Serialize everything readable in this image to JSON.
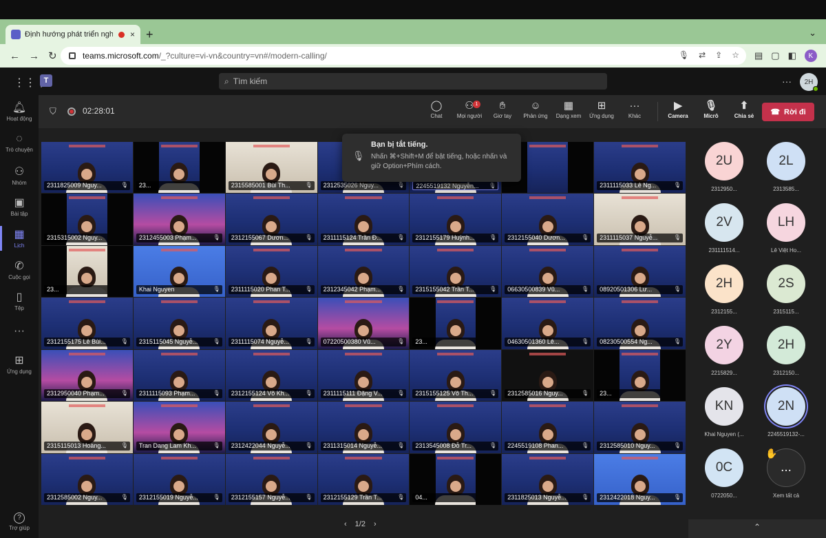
{
  "browser": {
    "tab_title": "Định hướng phát triển nghề",
    "tab_close": "×",
    "new_tab": "+",
    "url_domain": "teams.microsoft.com",
    "url_path": "/_?culture=vi-vn&country=vn#/modern-calling/",
    "profile_initial": "K"
  },
  "teams": {
    "search_placeholder": "Tìm kiếm",
    "user_initials": "2H",
    "rail": [
      "Hoạt động",
      "Trò chuyện",
      "Nhóm",
      "Bài tập",
      "Lịch",
      "Cuộc gọi",
      "Tệp",
      "",
      "Ứng dụng"
    ],
    "help": "Trợ giúp"
  },
  "meeting": {
    "timer": "02:28:01",
    "controls": [
      "Chat",
      "Mọi người",
      "Giơ tay",
      "Phản ứng",
      "Dạng xem",
      "Ứng dụng",
      "Khác"
    ],
    "people_badge": "1",
    "devices": [
      "Camera",
      "Micrô",
      "Chia sẻ"
    ],
    "leave": "Rời đi",
    "pager": "1/2"
  },
  "toast": {
    "title": "Bạn bị tắt tiếng.",
    "body": "Nhấn ⌘+Shift+M để bật tiếng, hoặc nhấn và giữ Option+Phím cách."
  },
  "grid_names": [
    "2311825009 Nguy...",
    "23...",
    "2315585001 Bùi Th...",
    "2312535026 Nguy...",
    "2245519132 Nguyễn...",
    "",
    "2311115033 Lê Ng...",
    "2315315002 Nguy...",
    "2312455003 Phạm...",
    "2312155067 Dươn...",
    "2311115124 Trần Đ...",
    "2312155179 Huỳnh...",
    "2312155040 Dươn...",
    "2311115037 Nguyễ...",
    "23...",
    "Khai Nguyen",
    "2311115020 Phan T...",
    "2312345042 Phạm...",
    "2315155042 Trần T...",
    "06630500839 Vũ...",
    "08920501306 Lư...",
    "2312155175 Lê Bùi...",
    "2315115045 Nguyễ...",
    "2311115074 Nguyễ...",
    "07220500380 Vũ...",
    "23...",
    "04630501360 Lê...",
    "08230500554 Ng...",
    "2312950040 Phạm...",
    "2311115093 Phạm...",
    "2312155124 Võ Kh...",
    "2311115111 Đặng V...",
    "2315155125 Võ Th...",
    "2312585016 Nguy...",
    "23...",
    "2315115013 Hoàng...",
    "Tran Dang Lam Kh...",
    "2312422044 Nguyễ...",
    "2311315014 Nguyễ...",
    "2313545008 Đỗ Tr...",
    "2245519108 Phan...",
    "2312585010 Nguy...",
    "2312585002 Nguy...",
    "2312155019 Nguyễ...",
    "2312155157 Nguyễ...",
    "2312155129 Trần T...",
    "04...",
    "2311825013 Nguyễ...",
    "2312422018 Nguy..."
  ],
  "roster": [
    {
      "initials": "2U",
      "label": "2312950...",
      "color": "#f9d4d4"
    },
    {
      "initials": "2L",
      "label": "2313585...",
      "color": "#cfe0f5"
    },
    {
      "initials": "2V",
      "label": "231111514...",
      "color": "#d7e6ef"
    },
    {
      "initials": "LH",
      "label": "Lê Việt Ho...",
      "color": "#f6d6df"
    },
    {
      "initials": "2H",
      "label": "2312155...",
      "color": "#fbe3c9"
    },
    {
      "initials": "2S",
      "label": "2315115...",
      "color": "#dbe9d2"
    },
    {
      "initials": "2Y",
      "label": "2215829...",
      "color": "#f3d3e3"
    },
    {
      "initials": "2H",
      "label": "2312150...",
      "color": "#d3ead8"
    },
    {
      "initials": "KN",
      "label": "Khai Nguyen (...",
      "color": "#e4e4ea"
    },
    {
      "initials": "2N",
      "label": "2245519132-...",
      "color": "#cfe0f5"
    },
    {
      "initials": "0C",
      "label": "0722050...",
      "color": "#d2e4f4"
    },
    {
      "initials": "...",
      "label": "Xem tất cả",
      "color": "#2a2a2a"
    }
  ],
  "colors": {
    "accent": "#7f85f5",
    "leave": "#c4314b",
    "chrome": "#9ac795"
  }
}
